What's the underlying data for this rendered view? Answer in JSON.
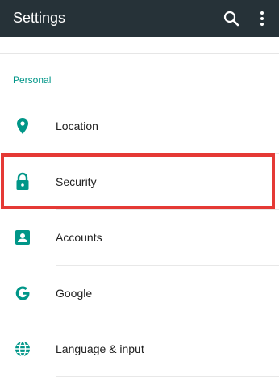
{
  "appbar": {
    "title": "Settings",
    "search_icon": "search-icon",
    "more_icon": "more-vert-icon"
  },
  "section": {
    "label": "Personal"
  },
  "items": [
    {
      "label": "Location",
      "icon": "location-pin-icon"
    },
    {
      "label": "Security",
      "icon": "lock-icon"
    },
    {
      "label": "Accounts",
      "icon": "account-box-icon"
    },
    {
      "label": "Google",
      "icon": "google-g-icon"
    },
    {
      "label": "Language & input",
      "icon": "globe-icon"
    }
  ],
  "colors": {
    "appbar_bg": "#263238",
    "accent": "#009688",
    "highlight": "#e53935",
    "text": "#212121"
  }
}
